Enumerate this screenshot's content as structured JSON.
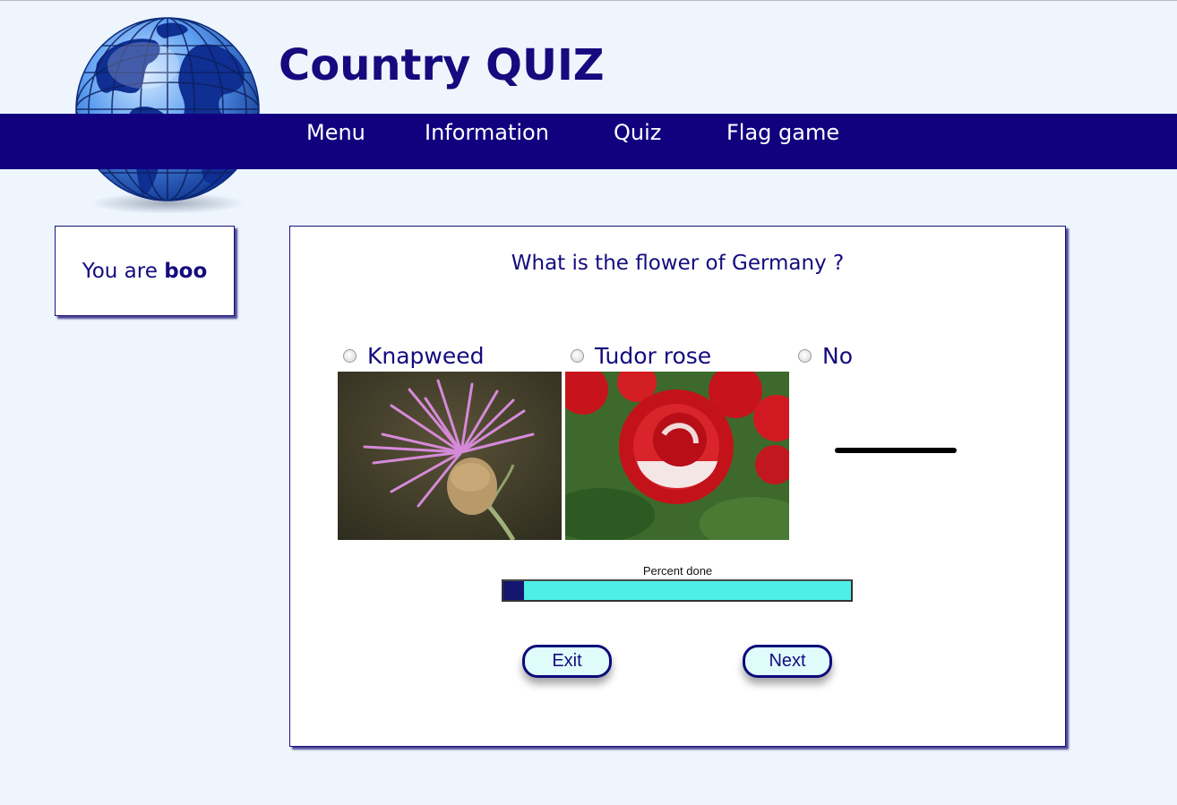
{
  "header": {
    "title": "Country QUIZ",
    "nav": [
      {
        "label": "Menu"
      },
      {
        "label": "Information"
      },
      {
        "label": "Quiz"
      },
      {
        "label": "Flag game"
      }
    ]
  },
  "user": {
    "prefix": "You are",
    "name": "boo"
  },
  "quiz": {
    "question": "What is the flower of Germany ?",
    "options": [
      {
        "label": "Knapweed",
        "selected": false,
        "image": "knapweed-flower"
      },
      {
        "label": "Tudor rose",
        "selected": false,
        "image": "red-rose"
      },
      {
        "label": "No",
        "selected": false,
        "image": "dash-line"
      }
    ],
    "progress": {
      "caption": "Percent done",
      "percent": 6
    },
    "buttons": {
      "exit_label": "Exit",
      "next_label": "Next"
    }
  },
  "colors": {
    "page_bg": "#eef5fd",
    "nav_bg": "#12007f",
    "text": "#150a7e",
    "progress_fill": "#141670",
    "progress_bg": "#4ef0e6",
    "button_bg": "#dffcfb"
  }
}
